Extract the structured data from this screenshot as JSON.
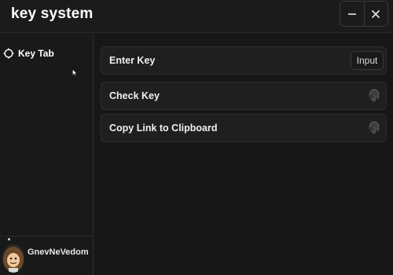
{
  "window": {
    "title": "key system",
    "minimize_icon": "minus-icon",
    "close_icon": "close-icon"
  },
  "sidebar": {
    "items": [
      {
        "label": "Key Tab",
        "icon": "crosshair-icon"
      }
    ],
    "profile": {
      "username": "GnevNeVedom"
    }
  },
  "main": {
    "rows": [
      {
        "label": "Enter Key",
        "input_placeholder": "Input"
      },
      {
        "label": "Check Key",
        "icon": "fingerprint-icon"
      },
      {
        "label": "Copy Link to Clipboard",
        "icon": "fingerprint-icon"
      }
    ]
  },
  "colors": {
    "background": "#191919",
    "panel": "#1f1f1f",
    "border": "#2e2e2e",
    "text": "#f2f2f2"
  }
}
